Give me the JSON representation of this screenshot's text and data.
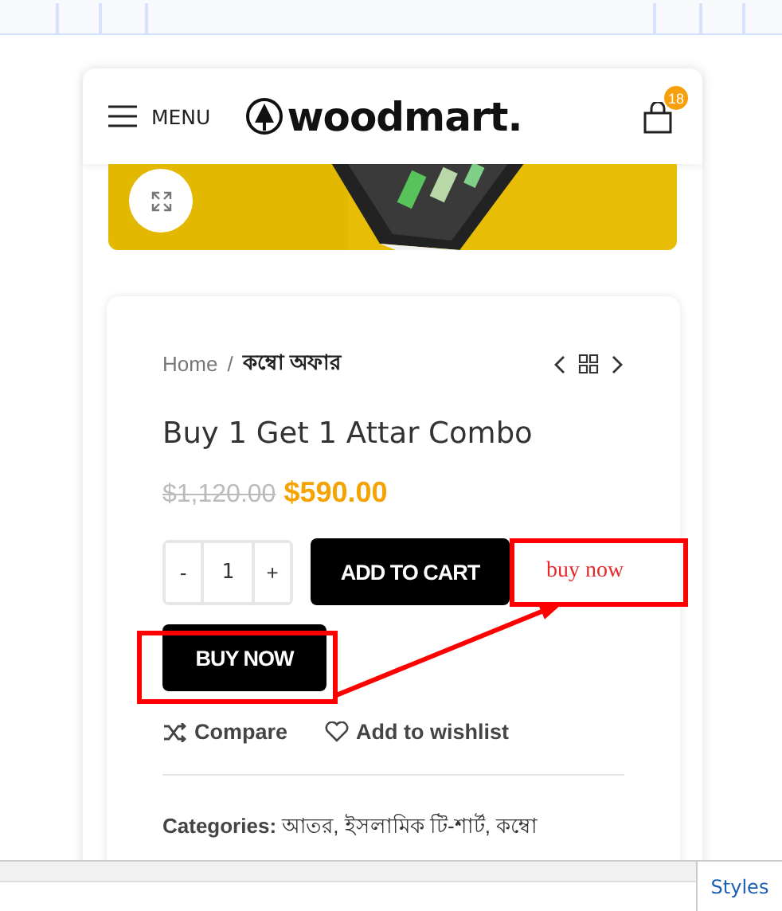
{
  "header": {
    "menu_label": "MENU",
    "logo_text": "woodmart.",
    "cart_count": "18"
  },
  "breadcrumb": [
    {
      "label": "Home"
    },
    {
      "label": "কম্বো অফার"
    }
  ],
  "breadcrumb_separator": "/",
  "product": {
    "title": "Buy 1 Get 1 Attar Combo",
    "old_price": "$1,120.00",
    "price": "$590.00"
  },
  "quantity": {
    "minus": "-",
    "value": "1",
    "plus": "+"
  },
  "add_to_cart": "ADD TO CART",
  "buy_now_link": "buy now",
  "buy_now_button": "BUY NOW",
  "actions": [
    {
      "kind": "compare",
      "label": "Compare"
    },
    {
      "kind": "wishlist",
      "label": "Add to wishlist"
    }
  ],
  "categories": {
    "label": "Categories:",
    "value": "আতর, ইসলামিক টি-শার্ট, কম্বো"
  },
  "devtools": {
    "tab": "Styles"
  }
}
